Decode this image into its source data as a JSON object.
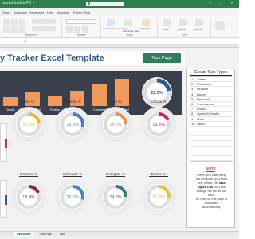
{
  "titlebar": {
    "file_label": "saved to this PC ˅",
    "minimize": "–",
    "maximize": "□",
    "close": "✕"
  },
  "ribbon": {
    "tabs": [
      "View",
      "Automate",
      "Developer",
      "Help",
      "Acrobat",
      "Power Pivot"
    ],
    "groups": [
      "Alignment",
      "Number",
      "Styles",
      "Cells"
    ],
    "style_buttons": [
      "Conditional Formatting",
      "Format as Table",
      "Cell Styles"
    ],
    "cell_buttons": [
      "Insert",
      "Delete",
      "Format"
    ]
  },
  "formula": {
    "fx": "fx"
  },
  "banner": {
    "title": "y Tracker Excel Template",
    "button": "Task Page"
  },
  "status_panel": {
    "labels": [
      "Detaile",
      "Reassigned",
      "Review",
      "Hold",
      "Cancelled",
      "Completed"
    ],
    "values": [
      5,
      8,
      6,
      9,
      13,
      16
    ],
    "donut_value": "22.9%",
    "donut_fraction": 0.229
  },
  "priority": {
    "items": [
      {
        "label": "Low %",
        "value": "22.9%",
        "fraction": 0.229,
        "color": "#e8b931"
      },
      {
        "label": "Medium %",
        "value": "29.2%",
        "fraction": 0.292,
        "color": "#4d7ec2"
      },
      {
        "label": "High %",
        "value": "24.8%",
        "fraction": 0.248,
        "color": "#ee8e52"
      },
      {
        "label": "Critical %",
        "value": "18.4%",
        "fraction": 0.184,
        "color": "#c9245a"
      }
    ]
  },
  "schedule": {
    "items": [
      {
        "label": "Do Now %",
        "value": "18.4%",
        "fraction": 0.184,
        "color": "#9a1f3a"
      },
      {
        "label": "Schedule %",
        "value": "29.2%",
        "fraction": 0.292,
        "color": "#4d7ec2"
      },
      {
        "label": "Delegate %",
        "value": "24.8%",
        "fraction": 0.248,
        "color": "#2f7f72"
      },
      {
        "label": "Delete %",
        "value": "25.2%",
        "fraction": 0.252,
        "color": "#e0c234"
      }
    ]
  },
  "side": {
    "title": "Create Task Types",
    "items": [
      {
        "num": "1",
        "name": "Career"
      },
      {
        "num": "2",
        "name": "Education"
      },
      {
        "num": "3",
        "name": "Finance"
      },
      {
        "num": "4",
        "name": "Home"
      },
      {
        "num": "5",
        "name": "Personal"
      },
      {
        "num": "6",
        "name": "Professional"
      },
      {
        "num": "7",
        "name": "Project"
      },
      {
        "num": "8",
        "name": "Sports & Health"
      },
      {
        "num": "9",
        "name": "Work"
      },
      {
        "num": "10",
        "name": "Other"
      },
      {
        "num": "",
        "name": ""
      },
      {
        "num": "",
        "name": ""
      },
      {
        "num": "",
        "name": ""
      },
      {
        "num": "",
        "name": ""
      },
      {
        "num": "",
        "name": ""
      },
      {
        "num": "",
        "name": ""
      },
      {
        "num": "",
        "name": ""
      }
    ],
    "note_title": "NOTE",
    "note_lines": [
      "When you start using",
      "the template, you must",
      "first create the",
      "Task",
      "Types List.",
      "You can",
      "change the list as you",
      "want.",
      "All data on this page is",
      "calculated",
      "automatically."
    ]
  },
  "sheet_tabs": [
    "Dashboard",
    "Task Page",
    "Lists"
  ],
  "colors": {
    "accent": "#2e7d4e",
    "panel": "#3b3f4c",
    "bar": "#f29a5c",
    "title": "#2f5c84"
  }
}
